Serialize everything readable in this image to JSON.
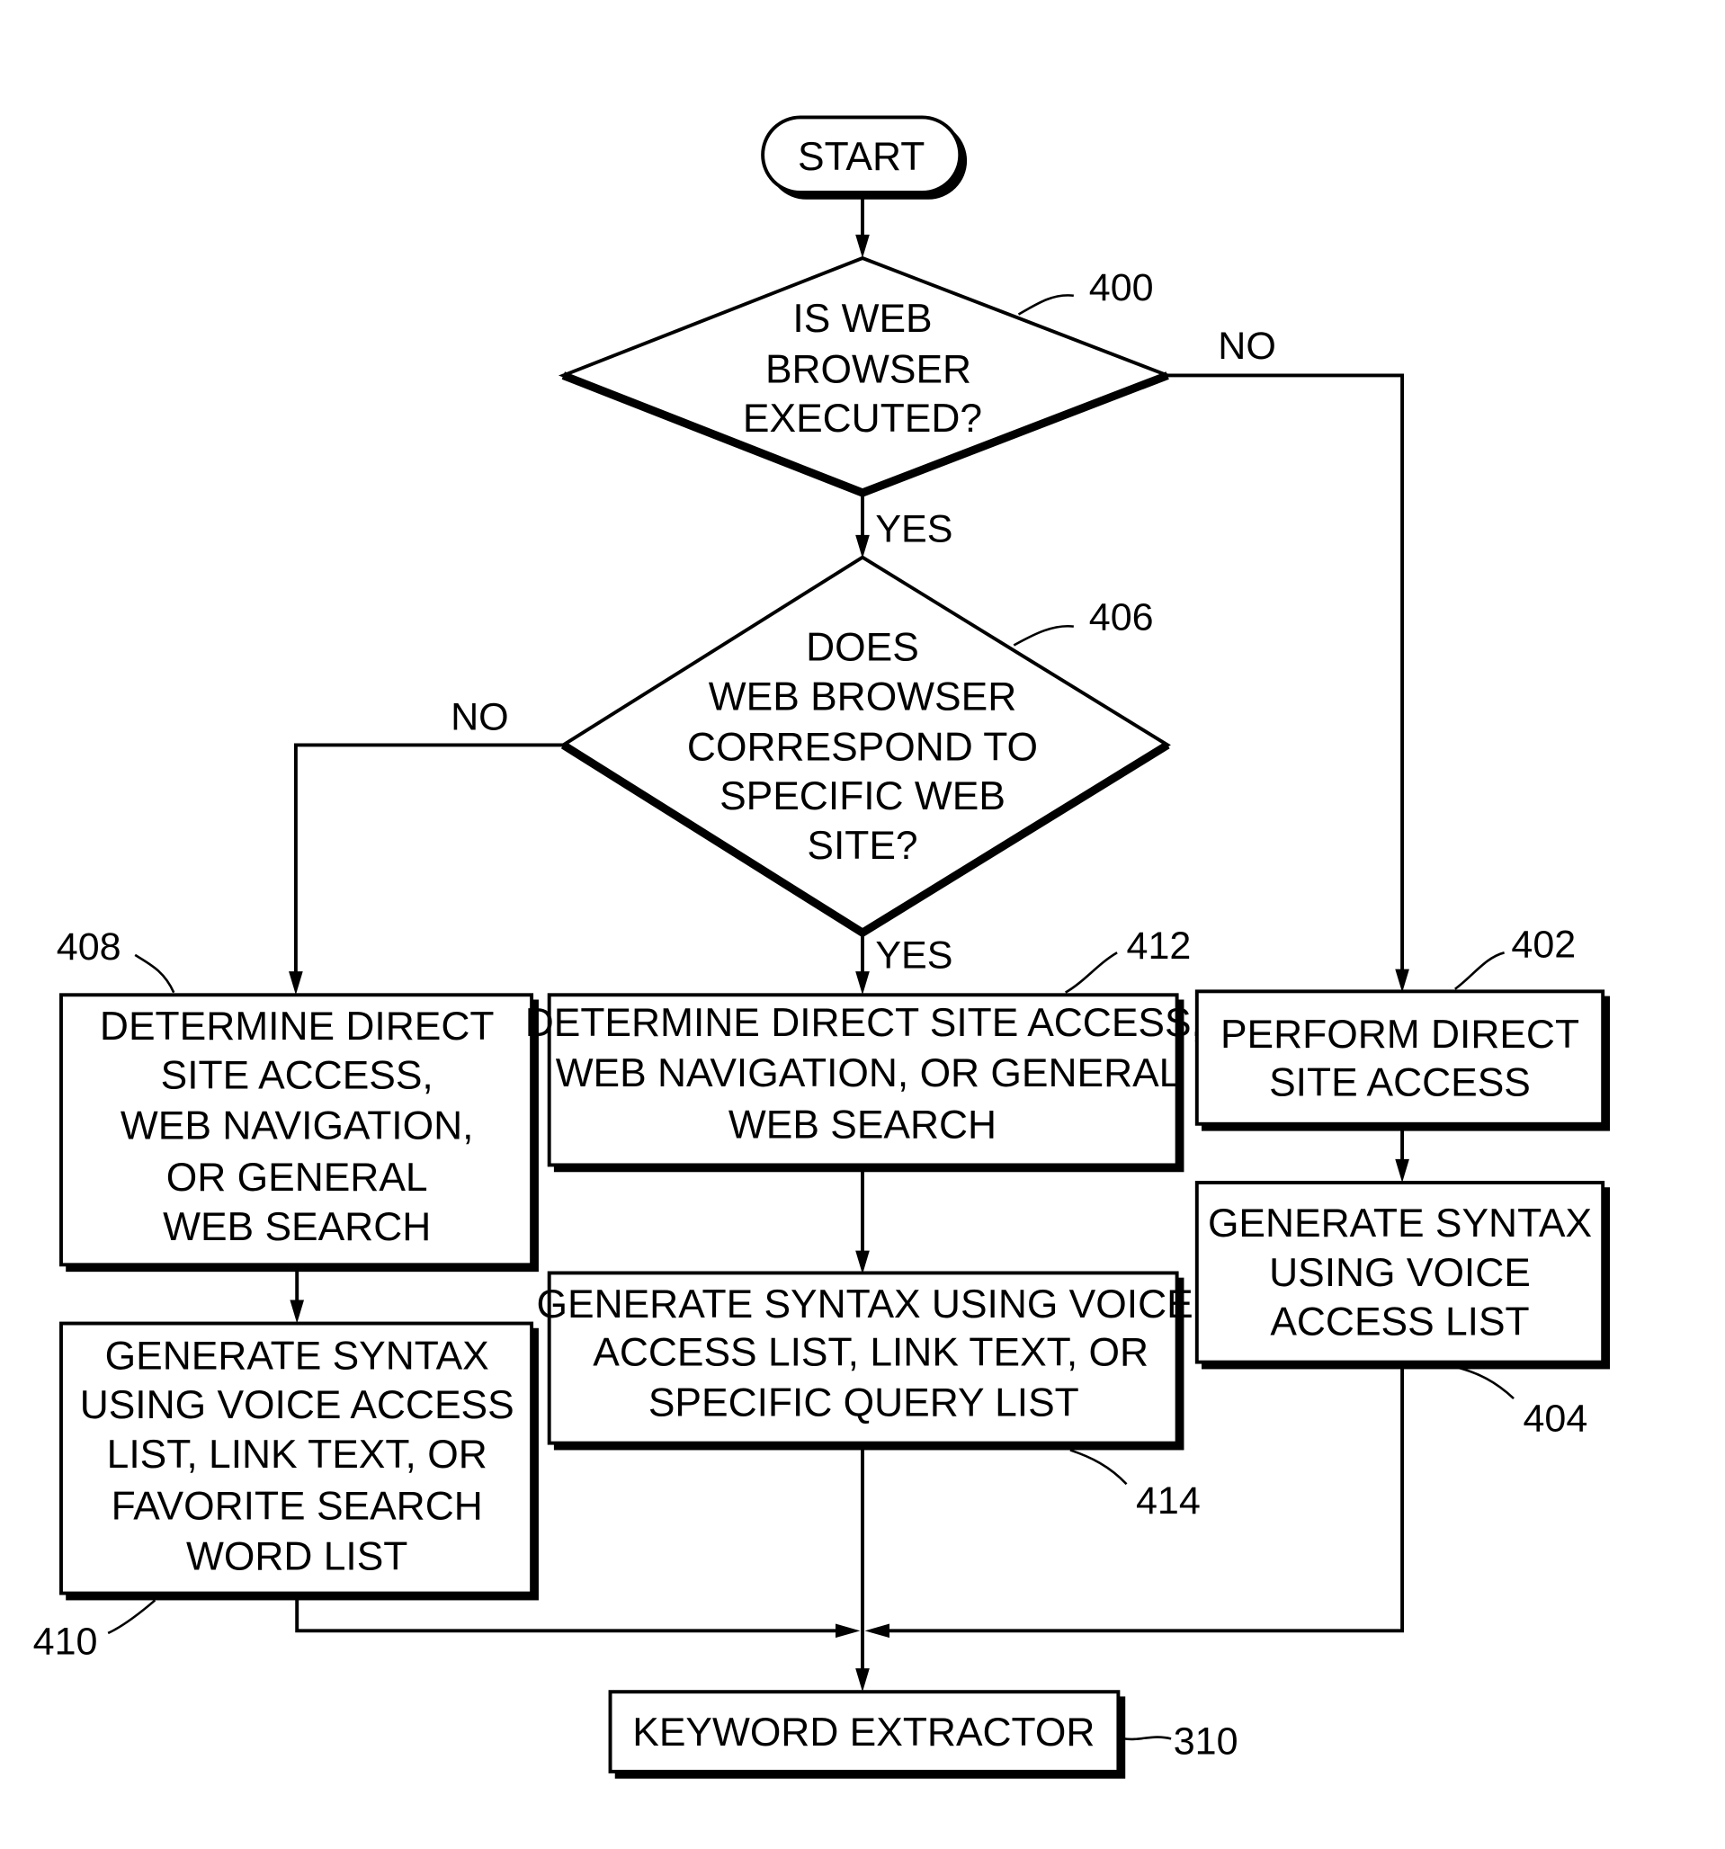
{
  "figure": {
    "start": "START",
    "decisions": [
      {
        "ref": "400",
        "lines": [
          "IS WEB",
          "BROWSER",
          "EXECUTED?"
        ],
        "yes": "YES",
        "no": "NO"
      },
      {
        "ref": "406",
        "lines": [
          "DOES",
          "WEB BROWSER",
          "CORRESPOND TO",
          "SPECIFIC WEB",
          "SITE?"
        ],
        "yes": "YES",
        "no": "NO"
      }
    ],
    "processes": {
      "p408": {
        "ref": "408",
        "lines": [
          "DETERMINE DIRECT",
          "SITE ACCESS,",
          "WEB NAVIGATION,",
          "OR GENERAL",
          "WEB SEARCH"
        ]
      },
      "p410": {
        "ref": "410",
        "lines": [
          "GENERATE SYNTAX",
          "USING VOICE ACCESS",
          "LIST, LINK TEXT, OR",
          "FAVORITE SEARCH",
          "WORD LIST"
        ]
      },
      "p412": {
        "ref": "412",
        "lines": [
          "DETERMINE DIRECT SITE ACCESS,",
          "WEB NAVIGATION, OR GENERAL",
          "WEB SEARCH"
        ]
      },
      "p414": {
        "ref": "414",
        "lines": [
          "GENERATE SYNTAX USING VOICE",
          "ACCESS LIST, LINK TEXT, OR",
          "SPECIFIC QUERY LIST"
        ]
      },
      "p402": {
        "ref": "402",
        "lines": [
          "PERFORM DIRECT",
          "SITE ACCESS"
        ]
      },
      "p404": {
        "ref": "404",
        "lines": [
          "GENERATE SYNTAX",
          "USING VOICE",
          "ACCESS LIST"
        ]
      }
    },
    "end": {
      "ref": "310",
      "label": "KEYWORD EXTRACTOR"
    }
  }
}
